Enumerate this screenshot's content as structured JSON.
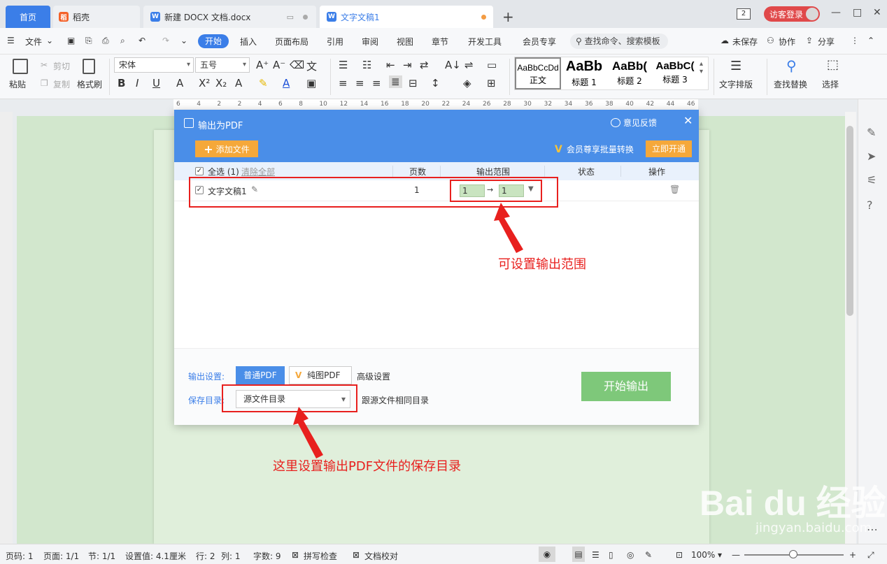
{
  "tabs": {
    "home": "首页",
    "daoke": "稻壳",
    "docx": "新建 DOCX 文档.docx",
    "current": "文字文稿1",
    "add": "+"
  },
  "window": {
    "badge": "2",
    "login": "访客登录",
    "minimize": "—",
    "maximize": "□",
    "close": "✕"
  },
  "menu": {
    "file": "文件",
    "start": "开始",
    "insert": "插入",
    "layout": "页面布局",
    "reference": "引用",
    "review": "审阅",
    "view": "视图",
    "chapter": "章节",
    "devtools": "开发工具",
    "vip": "会员专享",
    "search": "查找命令、搜索模板",
    "unsaved": "未保存",
    "collab": "协作",
    "share": "分享"
  },
  "ribbon": {
    "paste": "粘贴",
    "cut": "剪切",
    "copy": "复制",
    "format_painter": "格式刷",
    "font": "宋体",
    "size": "五号",
    "styles": [
      {
        "preview": "AaBbCcDd",
        "name": "正文"
      },
      {
        "preview": "AaBb",
        "name": "标题 1"
      },
      {
        "preview": "AaBb(",
        "name": "标题 2"
      },
      {
        "preview": "AaBbC(",
        "name": "标题 3"
      }
    ],
    "text_layout": "文字排版",
    "find_replace": "查找替换",
    "select": "选择"
  },
  "ruler": [
    "6",
    "4",
    "2",
    "2",
    "4",
    "6",
    "8",
    "10",
    "12",
    "14",
    "16",
    "18",
    "20",
    "22",
    "24",
    "26",
    "28",
    "30",
    "32",
    "34",
    "36",
    "38",
    "40",
    "42",
    "44",
    "46"
  ],
  "dialog": {
    "title": "输出为PDF",
    "feedback": "意见反馈",
    "close": "✕",
    "add_file": "添加文件",
    "vip_batch": "会员尊享批量转换",
    "open_now": "立即开通",
    "select_all": "全选 (1)",
    "clear_all": "清除全部",
    "col_pages": "页数",
    "col_range": "输出范围",
    "col_status": "状态",
    "col_action": "操作",
    "row": {
      "name": "文字文稿1",
      "pages": "1",
      "range_from": "1",
      "range_to": "1"
    },
    "output_settings_label": "输出设置:",
    "normal_pdf": "普通PDF",
    "image_pdf": "纯图PDF",
    "advanced": "高级设置",
    "save_dir_label": "保存目录:",
    "save_dir_value": "源文件目录",
    "save_dir_hint": "跟源文件相同目录",
    "start_output": "开始输出"
  },
  "annotations": {
    "range": "可设置输出范围",
    "save_dir": "这里设置输出PDF文件的保存目录"
  },
  "watermark": {
    "logo": "Bai du 经验",
    "url": "jingyan.baidu.com"
  },
  "status": {
    "page_num": "页码: 1",
    "pages": "页面: 1/1",
    "section": "节: 1/1",
    "setting": "设置值: 4.1厘米",
    "row": "行: 2",
    "col": "列: 1",
    "words": "字数: 9",
    "spell": "拼写检查",
    "proof": "文档校对",
    "zoom": "100%"
  },
  "colors": {
    "accent": "#3b7ee8",
    "dialog_header": "#4a8ee8",
    "orange": "#f5a83a",
    "annotation_red": "#e8201e",
    "start_button": "#7ec87a"
  }
}
